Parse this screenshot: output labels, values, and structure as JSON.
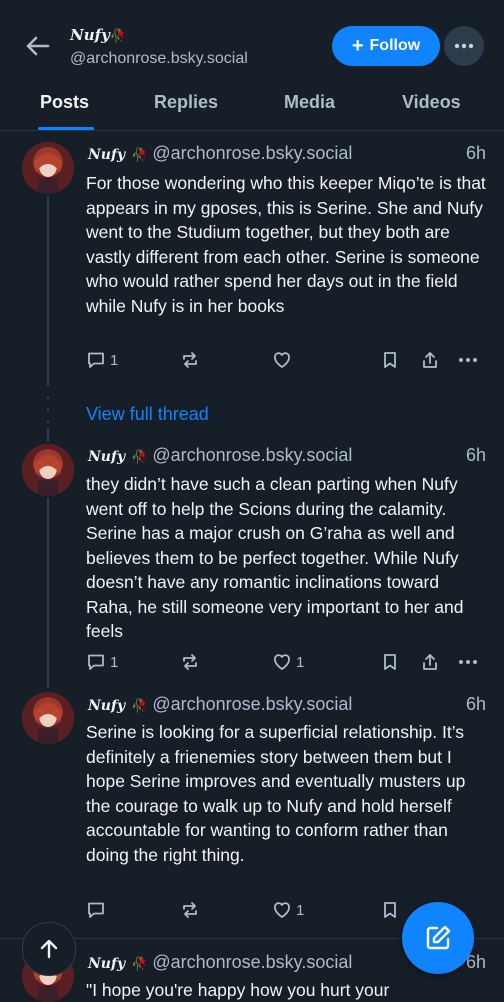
{
  "header": {
    "display_name": "Nufy",
    "rose": "🥀",
    "handle": "@archonrose.bsky.social",
    "follow_label": "Follow"
  },
  "tabs": [
    {
      "label": "Posts",
      "active": true
    },
    {
      "label": "Replies",
      "active": false
    },
    {
      "label": "Media",
      "active": false
    },
    {
      "label": "Videos",
      "active": false
    }
  ],
  "posts": [
    {
      "author": "Nufy",
      "rose": "🥀",
      "handle": "@archonrose.bsky.social",
      "time": "6h",
      "text": "For those wondering who this keeper Miqo’te is that appears in my gposes, this is Serine. She and Nufy went to the Studium together, but they both are vastly different from each other. Serine is someone who would rather spend her days out in the field while Nufy is in her books",
      "replies": "1",
      "reposts": "",
      "likes": ""
    },
    {
      "author": "Nufy",
      "rose": "🥀",
      "handle": "@archonrose.bsky.social",
      "time": "6h",
      "text": "they didn’t have such a clean parting when Nufy went off to help the Scions during the calamity. Serine has a major crush on G’raha as well and believes them to be perfect together. While Nufy doesn’t have any romantic inclinations toward Raha, he still someone very important to her and feels",
      "replies": "1",
      "reposts": "",
      "likes": "1"
    },
    {
      "author": "Nufy",
      "rose": "🥀",
      "handle": "@archonrose.bsky.social",
      "time": "6h",
      "text": "Serine is looking for a superficial relationship. It’s definitely a frienemies story between them but I hope Serine improves and eventually musters up the courage to walk up to Nufy and hold herself accountable for wanting to conform rather than doing the right thing.",
      "replies": "",
      "reposts": "",
      "likes": "1"
    },
    {
      "author": "Nufy",
      "rose": "🥀",
      "handle": "@archonrose.bsky.social",
      "time": "6h",
      "text": "\"I hope you're happy how you hurt your",
      "replies": "",
      "reposts": "",
      "likes": ""
    }
  ],
  "view_full_thread": "View full thread",
  "colors": {
    "background": "#161e27",
    "accent": "#1083fe",
    "muted": "#aebbc9",
    "text": "#f1f3f5"
  },
  "icons": [
    "back-arrow-icon",
    "plus-icon",
    "ellipsis-icon",
    "reply-icon",
    "repost-icon",
    "heart-icon",
    "bookmark-icon",
    "share-icon",
    "compose-icon",
    "arrow-up-icon"
  ]
}
